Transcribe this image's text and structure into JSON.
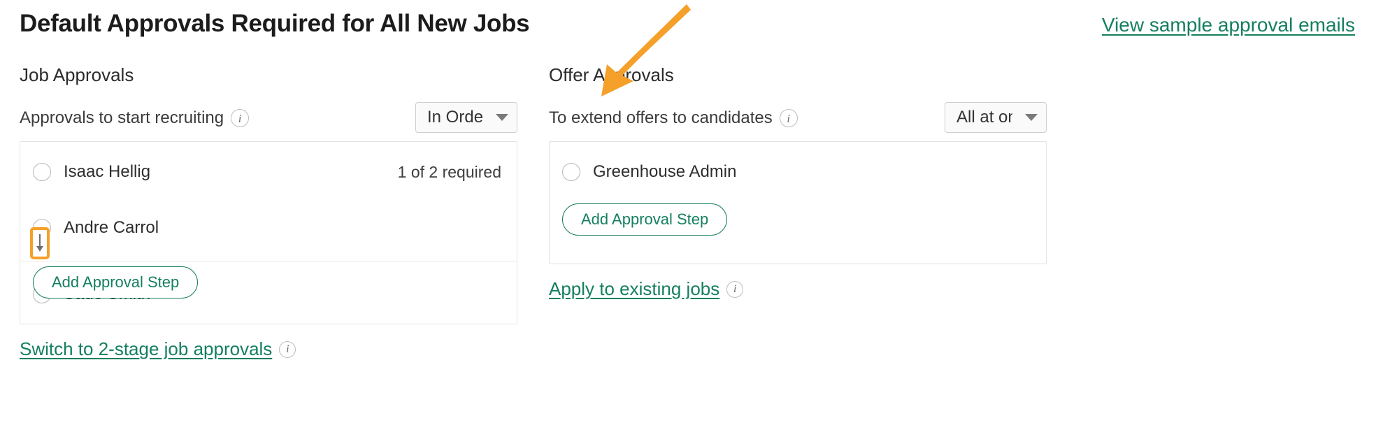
{
  "header": {
    "title": "Default Approvals Required for All New Jobs",
    "sample_link": "View sample approval emails"
  },
  "job_approvals": {
    "section_title": "Job Approvals",
    "subtitle": "Approvals to start recruiting",
    "info_glyph": "i",
    "mode_select": {
      "value": "In Order",
      "options": [
        "In Order",
        "All at once"
      ]
    },
    "approvers": [
      {
        "name": "Isaac Hellig",
        "note": "1 of 2 required"
      },
      {
        "name": "Andre Carrol",
        "note": ""
      },
      {
        "name": "Sade Smith",
        "note": ""
      }
    ],
    "drag_handle_icon": "arrow-down-icon",
    "add_step_label": "Add Approval Step",
    "footer_link": "Switch to 2-stage job approvals"
  },
  "offer_approvals": {
    "section_title": "Offer Approvals",
    "subtitle": "To extend offers to candidates",
    "info_glyph": "i",
    "mode_select": {
      "value": "All at on…",
      "options": [
        "In Order",
        "All at once"
      ]
    },
    "approvers": [
      {
        "name": "Greenhouse Admin",
        "note": ""
      }
    ],
    "add_step_label": "Add Approval Step",
    "footer_link": "Apply to existing jobs"
  },
  "colors": {
    "link_green": "#157f5f",
    "annotation_orange": "#f5a02a",
    "text_primary": "#262626",
    "panel_border": "#e3e3e3"
  }
}
